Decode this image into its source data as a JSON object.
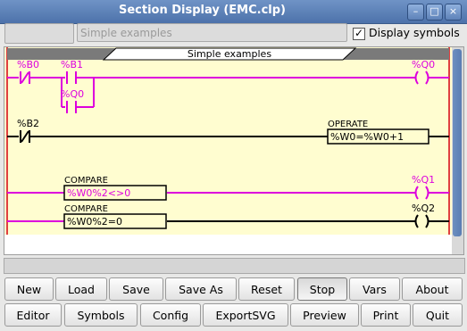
{
  "window": {
    "title": "Section Display (EMC.clp)"
  },
  "toolbar": {
    "section_field": "",
    "title_field": "Simple examples",
    "display_symbols_label": "Display symbols",
    "display_symbols_checked": "✓"
  },
  "ladder": {
    "section_banner": "Simple examples",
    "row1": {
      "contact_a": "%B0",
      "contact_b": "%B1",
      "contact_c": "%Q0",
      "coil": "%Q0"
    },
    "row2": {
      "contact": "%B2",
      "block_title": "OPERATE",
      "block_expr": "%W0=%W0+1"
    },
    "row3": {
      "block_title": "COMPARE",
      "block_expr": "%W0%2<>0",
      "coil": "%Q1"
    },
    "row4": {
      "block_title": "COMPARE",
      "block_expr": "%W0%2=0",
      "coil": "%Q2"
    }
  },
  "buttons_row1": [
    "New",
    "Load",
    "Save",
    "Save As",
    "Reset",
    "Stop",
    "Vars",
    "About"
  ],
  "buttons_row2": [
    "Editor",
    "Symbols",
    "Config",
    "ExportSVG",
    "Preview",
    "Print",
    "Quit"
  ],
  "colors": {
    "rung_active": "#dd00dd",
    "rail": "#e04040",
    "canvas_bg": "#fffdd0"
  }
}
